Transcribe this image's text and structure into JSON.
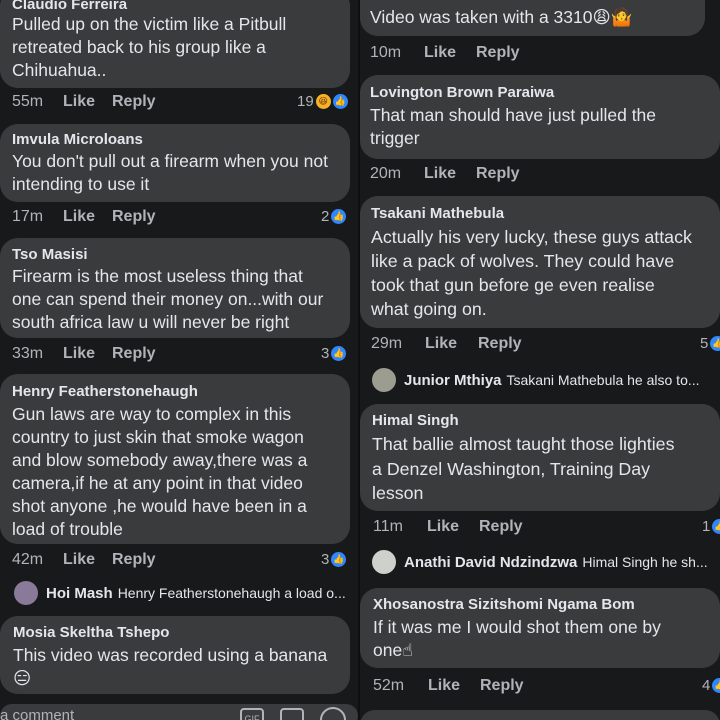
{
  "left": {
    "comments": [
      {
        "author": "Claudio Ferreira",
        "lines": [
          "Pulled up on the victim like a Pitbull",
          "retreated back to his group like a",
          "Chihuahua.."
        ],
        "time": "55m",
        "like": "Like",
        "reply": "Reply",
        "count": "19",
        "reactions": [
          "haha",
          "like"
        ]
      },
      {
        "author": "Imvula Microloans",
        "lines": [
          "You don't pull out a firearm when you not",
          "intending to use it"
        ],
        "time": "17m",
        "like": "Like",
        "reply": "Reply",
        "count": "2",
        "reactions": [
          "like"
        ]
      },
      {
        "author": "Tso Masisi",
        "lines": [
          "Firearm is the most useless thing that",
          "one can spend their money on...with our",
          "south africa law u will never be right"
        ],
        "time": "33m",
        "like": "Like",
        "reply": "Reply",
        "count": "3",
        "reactions": [
          "like"
        ]
      },
      {
        "author": "Henry Featherstonehaugh",
        "lines": [
          "Gun laws are way to complex in this",
          "country to just skin that smoke wagon",
          "and blow somebody away,there was a",
          "camera,if he at any point in that video",
          "shot anyone ,he would have been in a",
          "load of trouble"
        ],
        "time": "42m",
        "like": "Like",
        "reply": "Reply",
        "count": "3",
        "reactions": [
          "like"
        ]
      },
      {
        "author": "Mosia Skeltha Tshepo",
        "lines": [
          "This video was recorded using a banana"
        ],
        "emoji": "😑"
      }
    ],
    "reply_preview": {
      "name": "Hoi Mash",
      "text": "Henry Featherstonehaugh a load o..."
    },
    "composer_placeholder": "a comment",
    "composer_icons": [
      "GIF",
      "sticker-icon",
      "emoji-icon"
    ]
  },
  "right": {
    "comments": [
      {
        "author": "",
        "lines": [
          "Video was taken with a 3310😩🤷"
        ],
        "time": "10m",
        "like": "Like",
        "reply": "Reply"
      },
      {
        "author": "Lovington Brown Paraiwa",
        "lines": [
          "That man should have just pulled the",
          "trigger"
        ],
        "time": "20m",
        "like": "Like",
        "reply": "Reply"
      },
      {
        "author": "Tsakani Mathebula",
        "lines": [
          "Actually his very lucky, these guys attack",
          "like a pack of wolves. They could have",
          "took that gun before ge even realise",
          "what going on."
        ],
        "time": "29m",
        "like": "Like",
        "reply": "Reply",
        "count": "5"
      },
      {
        "author": "Himal Singh",
        "lines": [
          "That ballie almost taught those lighties",
          "a Denzel Washington, Training Day",
          "lesson"
        ],
        "time": "11m",
        "like": "Like",
        "reply": "Reply",
        "count": "1"
      },
      {
        "author": "Xhosanostra Sizitshomi Ngama Bom",
        "lines": [
          "If it was me I would shot them one by",
          "one☝"
        ],
        "time": "52m",
        "like": "Like",
        "reply": "Reply",
        "count": "4"
      }
    ],
    "reply_previews": [
      {
        "name": "Junior Mthiya",
        "text": "Tsakani Mathebula he also to..."
      },
      {
        "name": "Anathi David Ndzindzwa",
        "text": "Himal Singh he sh..."
      }
    ]
  },
  "colors": {
    "background": "#18191a",
    "bubble": "#3a3b3c",
    "text": "#e4e6eb",
    "muted": "#b0b3b8",
    "like_blue": "#2d88ff",
    "haha_yellow": "#f7b125"
  }
}
